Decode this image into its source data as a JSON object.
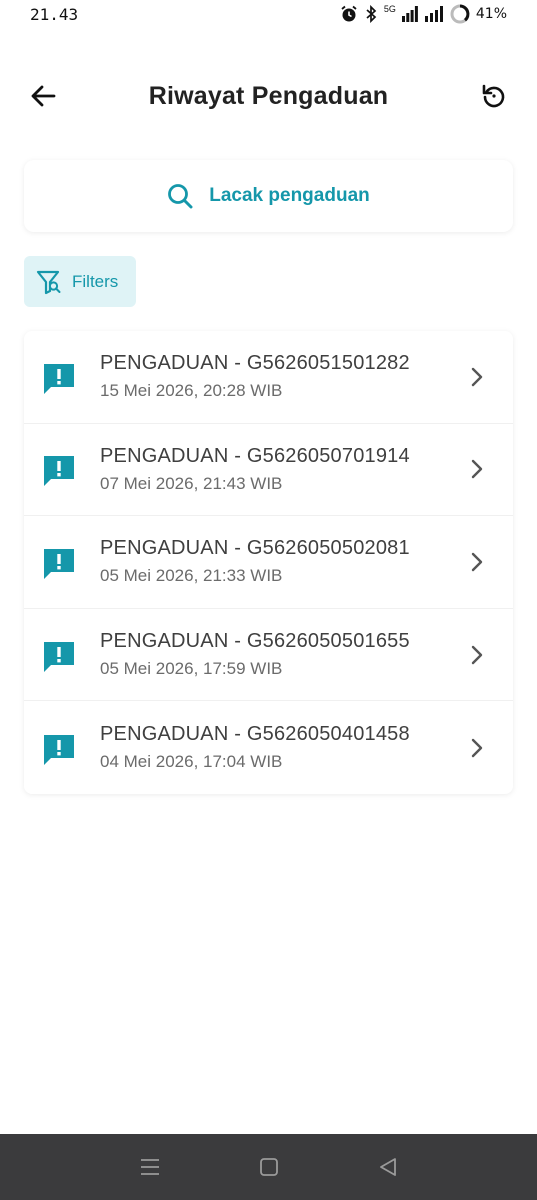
{
  "status_bar": {
    "time": "21.43",
    "network": "5G",
    "battery": "41%"
  },
  "header": {
    "title": "Riwayat Pengaduan",
    "back_icon": "arrow-left-icon",
    "refresh_icon": "refresh-icon"
  },
  "track": {
    "label": "Lacak pengaduan",
    "icon": "search-icon"
  },
  "filters": {
    "label": "Filters",
    "icon": "filter-icon"
  },
  "complaints": [
    {
      "title": "PENGADUAN - G5626051501282",
      "date": "15 Mei 2026, 20:28 WIB"
    },
    {
      "title": "PENGADUAN - G5626050701914",
      "date": "07 Mei 2026, 21:43 WIB"
    },
    {
      "title": "PENGADUAN - G5626050502081",
      "date": "05 Mei 2026, 21:33 WIB"
    },
    {
      "title": "PENGADUAN - G5626050501655",
      "date": "05 Mei 2026, 17:59 WIB"
    },
    {
      "title": "PENGADUAN - G5626050401458",
      "date": "04 Mei 2026, 17:04 WIB"
    }
  ],
  "colors": {
    "accent": "#1597aa",
    "accent_bg": "#dff3f6",
    "nav_bg": "#3b3b3d"
  }
}
